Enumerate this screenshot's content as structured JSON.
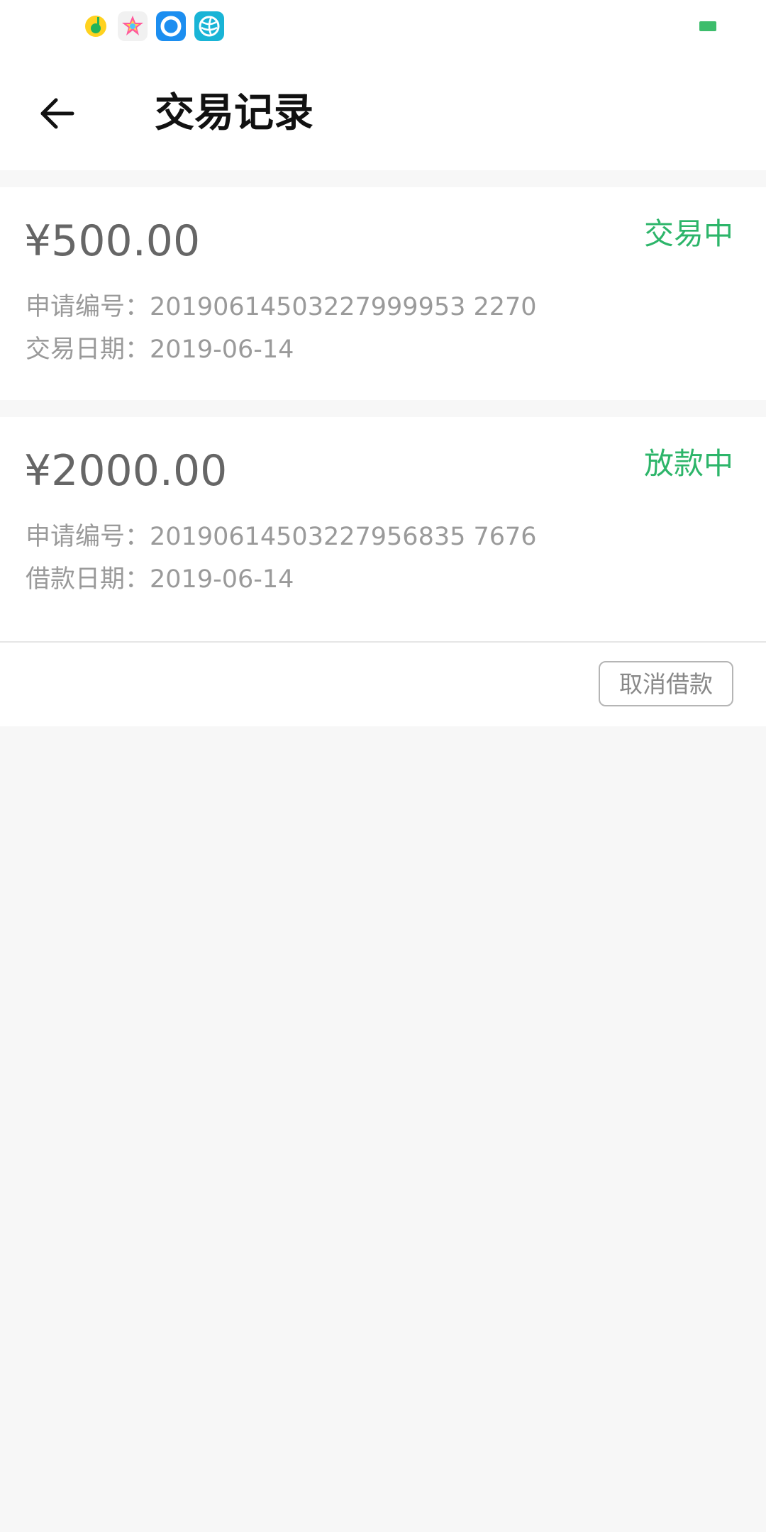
{
  "header": {
    "title": "交易记录"
  },
  "status_bar": {
    "icons": [
      "qq-music-icon",
      "photos-icon",
      "browser-icon",
      "basketball-app-icon"
    ]
  },
  "records": [
    {
      "amount": "¥500.00",
      "status": "交易中",
      "application_label": "申请编号：",
      "application_no": "20190614503227999953 2270",
      "date_label": "交易日期：",
      "date": "2019-06-14"
    },
    {
      "amount": "¥2000.00",
      "status": "放款中",
      "application_label": "申请编号：",
      "application_no": "20190614503227956835 7676",
      "date_label": "借款日期：",
      "date": "2019-06-14",
      "action_label": "取消借款"
    }
  ],
  "colors": {
    "accent": "#2db56a",
    "amount": "#666666",
    "meta": "#9a9a9a",
    "background": "#f7f7f7"
  }
}
